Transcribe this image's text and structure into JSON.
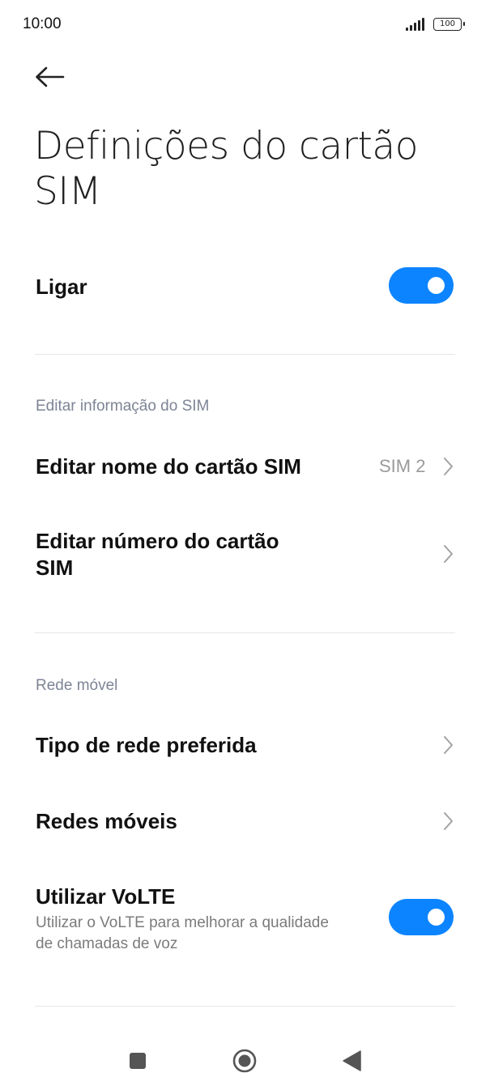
{
  "status_bar": {
    "time": "10:00",
    "battery_level": "100",
    "signal_icon": "cellular-signal-icon",
    "battery_icon": "battery-icon"
  },
  "header": {
    "back_icon": "arrow-left-icon",
    "title": "Definições do cartão SIM"
  },
  "colors": {
    "accent": "#0d84ff",
    "section_header": "#7d8495",
    "secondary_text": "#7b7b7b",
    "divider": "#e6e6e6"
  },
  "power": {
    "label": "Ligar",
    "enabled": true
  },
  "sim_info": {
    "header": "Editar informação do SIM",
    "edit_name": {
      "label": "Editar nome do cartão SIM",
      "value": "SIM 2"
    },
    "edit_number": {
      "label_line1": "Editar número do cartão",
      "label_line2": "SIM"
    }
  },
  "mobile_network": {
    "header": "Rede móvel",
    "preferred_type": {
      "label": "Tipo de rede preferida"
    },
    "mobile_networks": {
      "label": "Redes móveis"
    },
    "volte": {
      "label": "Utilizar VoLTE",
      "description_line1": "Utilizar o VoLTE para melhorar a qualidade",
      "description_line2": "de chamadas de voz",
      "enabled": true
    }
  },
  "nav_bar": {
    "recents_icon": "square-recents-icon",
    "home_icon": "circle-home-icon",
    "back_icon": "triangle-back-icon"
  }
}
